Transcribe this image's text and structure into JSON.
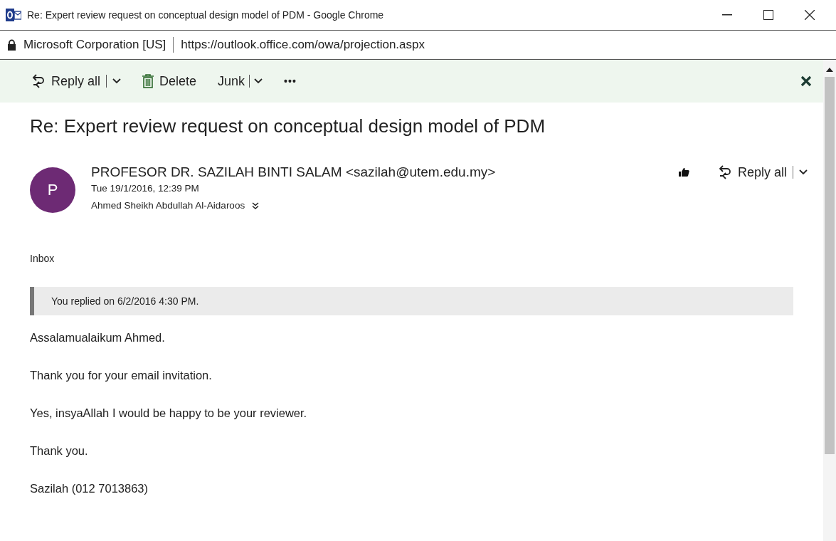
{
  "window": {
    "title": "Re: Expert review request on conceptual design model of PDM - Google Chrome"
  },
  "address_bar": {
    "site": "Microsoft Corporation [US]",
    "url": "https://outlook.office.com/owa/projection.aspx"
  },
  "toolbar": {
    "items": [
      {
        "kind": "reply_all",
        "label": "Reply all"
      },
      {
        "kind": "delete",
        "label": "Delete"
      },
      {
        "kind": "junk",
        "label": "Junk"
      },
      {
        "kind": "more",
        "label": "•••"
      }
    ]
  },
  "message": {
    "subject": "Re: Expert review request on conceptual design model of PDM",
    "avatar_letter": "P",
    "sender": "PROFESOR DR. SAZILAH BINTI SALAM <sazilah@utem.edu.my>",
    "date": "Tue 19/1/2016, 12:39 PM",
    "recipient": "Ahmed Sheikh Abdullah Al-Aidaroos",
    "reply_action": "Reply all",
    "folder": "Inbox",
    "reply_note": "You replied on 6/2/2016 4:30 PM.",
    "body": [
      "Assalamualaikum Ahmed.",
      "Thank you for your email invitation.",
      "Yes, insyaAllah I would be happy to be your reviewer.",
      "Thank you.",
      "Sazilah (012 7013863)"
    ]
  }
}
